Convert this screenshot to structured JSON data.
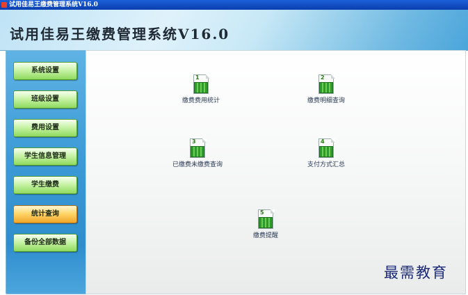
{
  "window": {
    "title": "试用佳易王缴费管理系统V16.0"
  },
  "header": {
    "title": "试用佳易王缴费管理系统V16.0"
  },
  "sidebar": {
    "items": [
      {
        "label": "系统设置"
      },
      {
        "label": "班级设置"
      },
      {
        "label": "费用设置"
      },
      {
        "label": "学生信息管理"
      },
      {
        "label": "学生缴费"
      },
      {
        "label": "统计查询",
        "active": true
      },
      {
        "label": "备份全部数据"
      }
    ]
  },
  "tiles": [
    {
      "num": "1",
      "label": "缴费费用统计"
    },
    {
      "num": "2",
      "label": "缴费明细查询"
    },
    {
      "num": "3",
      "label": "已缴费未缴费查询"
    },
    {
      "num": "4",
      "label": "支付方式汇总"
    },
    {
      "num": "5",
      "label": "缴费提醒"
    }
  ],
  "watermark": "最需教育",
  "colors": {
    "active_button": "#f0a62a",
    "nav_button": "#8fd95e",
    "sidebar": "#3c9ad6"
  }
}
